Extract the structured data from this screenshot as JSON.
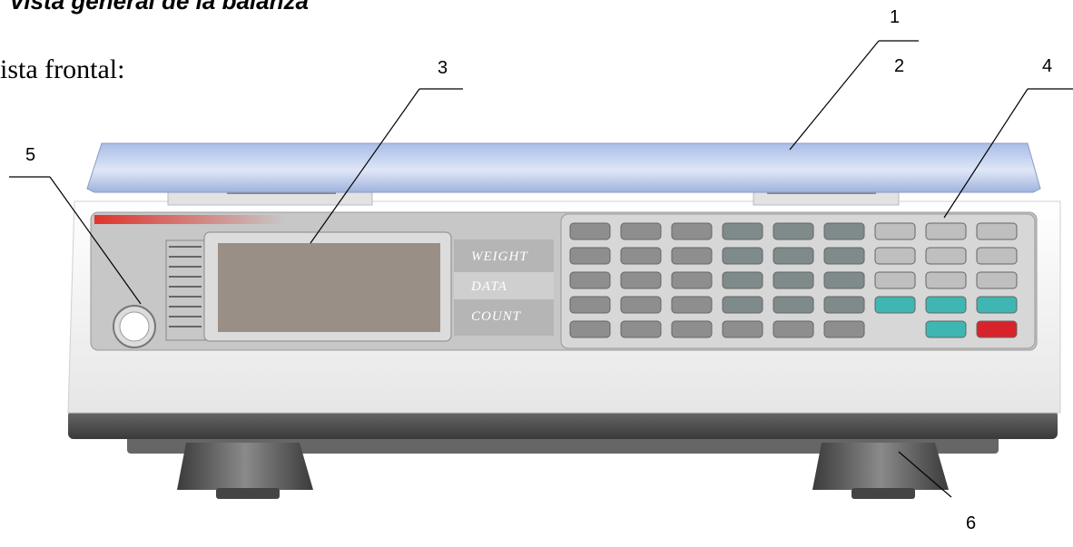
{
  "heading": "Vista general de la balanza",
  "subheading": "ista frontal:",
  "callouts": [
    "1",
    "2",
    "3",
    "4",
    "5",
    "6"
  ],
  "display_side_labels": [
    "WEIGHT",
    "DATA",
    "COUNT"
  ],
  "colors": {
    "platter": "#b9cbeb",
    "body": "#f4f4f4",
    "panel": "#c9c9c9",
    "keypad": "#d7d7d7",
    "key": "#8e8e8e",
    "key_accent": "#3fb6b1",
    "power_key": "#d7242b",
    "display": "#9a8f87",
    "base": "#4f4f4f"
  }
}
